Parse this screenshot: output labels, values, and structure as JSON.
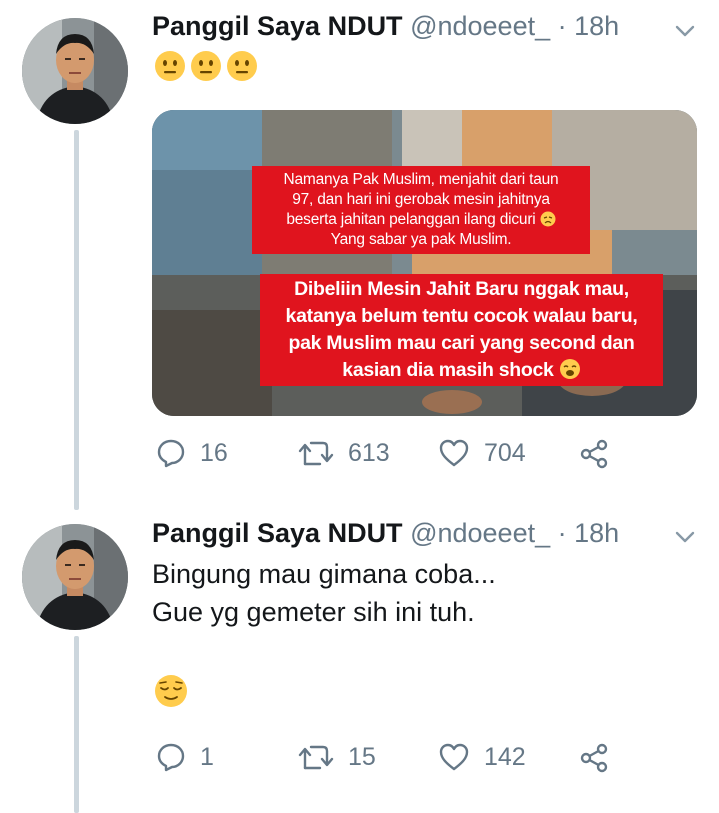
{
  "tweets": [
    {
      "display_name": "Panggil Saya NDUT",
      "handle": "@ndoeeet_",
      "time": "· 18h",
      "emojis": [
        "neutral-face",
        "neutral-face",
        "neutral-face"
      ],
      "media": {
        "caption_top": [
          "Namanya Pak Muslim, menjahit dari taun",
          "97, dan hari ini gerobak mesin jahitnya",
          "beserta jahitan pelanggan ilang dicuri",
          "Yang sabar ya pak Muslim."
        ],
        "caption_bottom": [
          "Dibeliin Mesin Jahit Baru nggak mau,",
          "katanya belum tentu cocok walau baru,",
          "pak Muslim mau cari yang second dan",
          "kasian dia masih shock"
        ]
      },
      "actions": {
        "replies": "16",
        "retweets": "613",
        "likes": "704"
      }
    },
    {
      "display_name": "Panggil Saya NDUT",
      "handle": "@ndoeeet_",
      "time": "· 18h",
      "text_lines": [
        "Bingung mau gimana coba...",
        "Gue yg gemeter sih ini tuh."
      ],
      "emoji": "relieved-face",
      "actions": {
        "replies": "1",
        "retweets": "15",
        "likes": "142"
      }
    }
  ],
  "colors": {
    "accent_text": "#14171a",
    "secondary_text": "#657786",
    "caption_bg": "#e0141e",
    "thread_line": "#ccd6dd"
  }
}
